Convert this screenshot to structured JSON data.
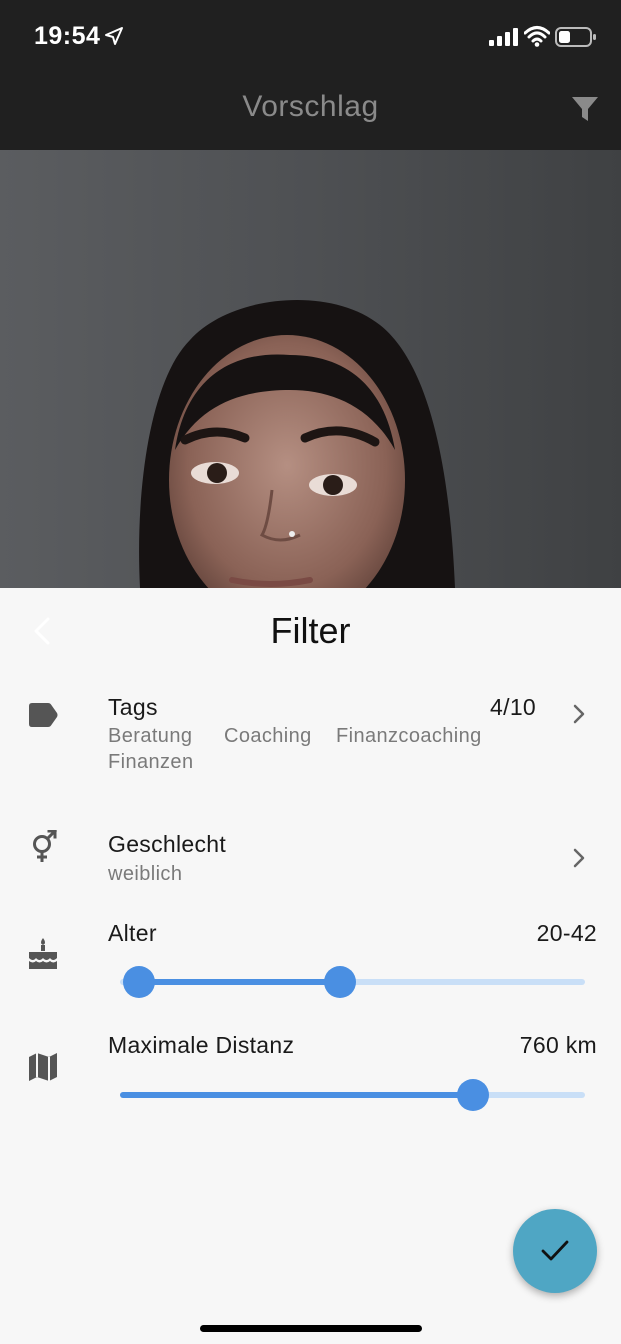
{
  "status_bar": {
    "time": "19:54"
  },
  "nav": {
    "title": "Vorschlag"
  },
  "sheet": {
    "title": "Filter",
    "tags": {
      "label": "Tags",
      "count": "4/10",
      "items": [
        "Beratung",
        "Coaching",
        "Finanzcoaching",
        "Finanzen"
      ]
    },
    "gender": {
      "label": "Geschlecht",
      "value": "weiblich"
    },
    "age": {
      "label": "Alter",
      "value": "20-42",
      "range_min": 20,
      "range_max": 42
    },
    "distance": {
      "label": "Maximale Distanz",
      "value": "760 km",
      "fraction": 0.76
    }
  },
  "colors": {
    "accent": "#4a8fe2",
    "fab": "#4fa6c4",
    "header": "#202020"
  }
}
